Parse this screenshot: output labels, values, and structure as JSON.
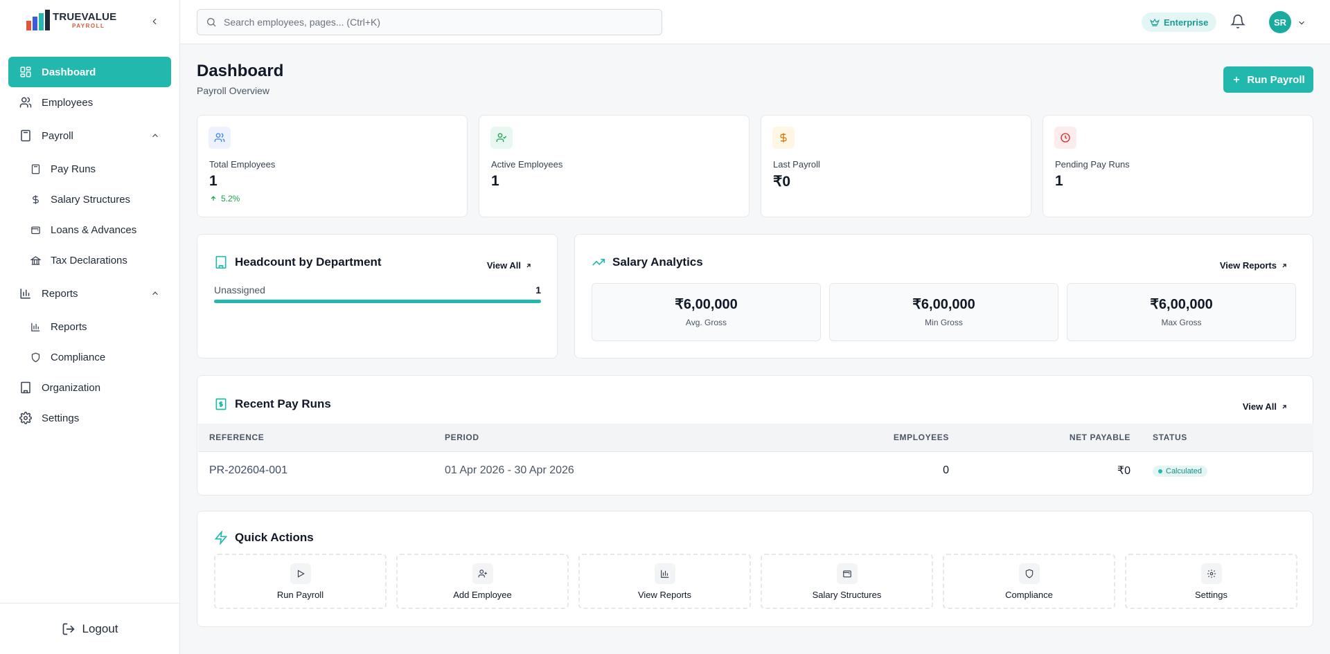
{
  "brand": {
    "name": "TRUEVALUE",
    "sub": "PAYROLL"
  },
  "sidebar": {
    "items": [
      {
        "label": "Dashboard"
      },
      {
        "label": "Employees"
      },
      {
        "label": "Payroll",
        "children": [
          {
            "label": "Pay Runs"
          },
          {
            "label": "Salary Structures"
          },
          {
            "label": "Loans & Advances"
          },
          {
            "label": "Tax Declarations"
          }
        ]
      },
      {
        "label": "Reports",
        "children": [
          {
            "label": "Reports"
          },
          {
            "label": "Compliance"
          }
        ]
      },
      {
        "label": "Organization"
      },
      {
        "label": "Settings"
      }
    ],
    "logout": "Logout"
  },
  "topbar": {
    "search_placeholder": "Search employees, pages... (Ctrl+K)",
    "plan": "Enterprise",
    "avatar_initials": "SR"
  },
  "page": {
    "title": "Dashboard",
    "subtitle": "Payroll Overview",
    "run_payroll": "Run Payroll"
  },
  "stats": [
    {
      "label": "Total Employees",
      "value": "1",
      "trend": "5.2%"
    },
    {
      "label": "Active Employees",
      "value": "1"
    },
    {
      "label": "Last Payroll",
      "value": "₹0"
    },
    {
      "label": "Pending Pay Runs",
      "value": "1"
    }
  ],
  "headcount": {
    "title": "Headcount by Department",
    "view_all": "View All",
    "rows": [
      {
        "dept": "Unassigned",
        "count": "1",
        "fraction": 1.0
      }
    ]
  },
  "salary": {
    "title": "Salary Analytics",
    "view_reports": "View Reports",
    "metrics": [
      {
        "value": "₹6,00,000",
        "label": "Avg. Gross"
      },
      {
        "value": "₹6,00,000",
        "label": "Min Gross"
      },
      {
        "value": "₹6,00,000",
        "label": "Max Gross"
      }
    ]
  },
  "payruns": {
    "title": "Recent Pay Runs",
    "view_all": "View All",
    "columns": [
      "REFERENCE",
      "PERIOD",
      "EMPLOYEES",
      "NET PAYABLE",
      "STATUS"
    ],
    "rows": [
      {
        "reference": "PR-202604-001",
        "period": "01 Apr 2026 - 30 Apr 2026",
        "employees": "0",
        "net": "₹0",
        "status": "Calculated"
      }
    ]
  },
  "quick_actions": {
    "title": "Quick Actions",
    "items": [
      {
        "label": "Run Payroll",
        "icon": "play-icon"
      },
      {
        "label": "Add Employee",
        "icon": "user-plus-icon"
      },
      {
        "label": "View Reports",
        "icon": "bar-chart-icon"
      },
      {
        "label": "Salary Structures",
        "icon": "wallet-icon"
      },
      {
        "label": "Compliance",
        "icon": "shield-icon"
      },
      {
        "label": "Settings",
        "icon": "gear-icon"
      }
    ]
  },
  "colors": {
    "accent": "#22b8ad",
    "success": "#16a34a",
    "warning": "#d97706",
    "danger": "#dc2626",
    "info": "#3b82f6"
  }
}
